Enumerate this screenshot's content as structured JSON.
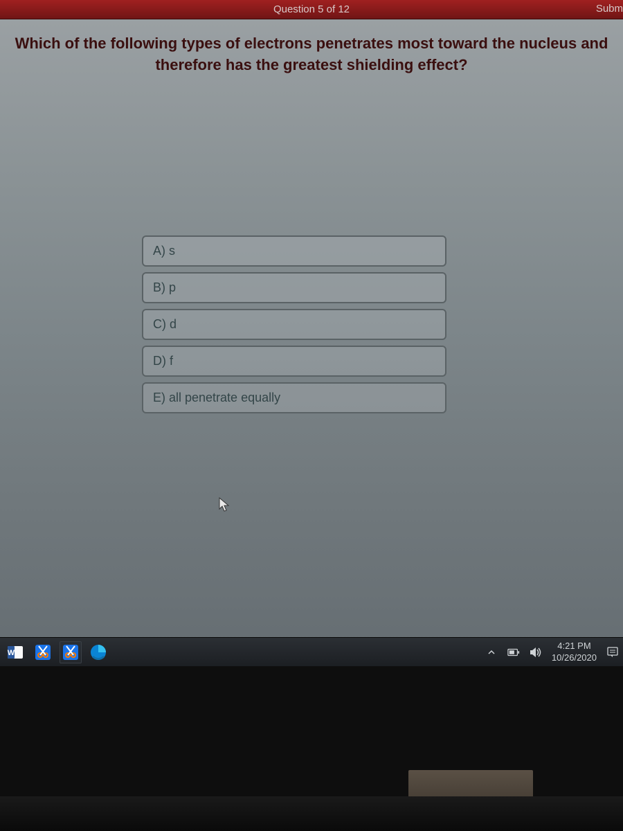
{
  "header": {
    "question_counter": "Question 5 of 12",
    "submit_label": "Subm"
  },
  "question": {
    "text": "Which of the following types of electrons penetrates most toward the nucleus and therefore has the greatest shielding effect?"
  },
  "answers": [
    {
      "label": "A) s"
    },
    {
      "label": "B) p"
    },
    {
      "label": "C) d"
    },
    {
      "label": "D) f"
    },
    {
      "label": "E) all penetrate equally"
    }
  ],
  "taskbar": {
    "time": "4:21 PM",
    "date": "10/26/2020"
  }
}
